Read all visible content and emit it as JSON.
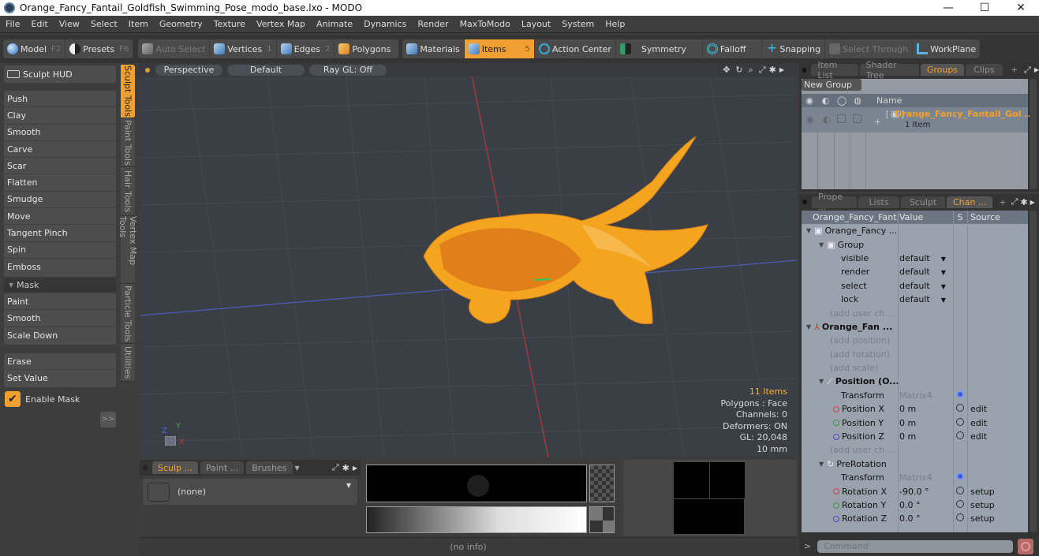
{
  "window": {
    "title": "Orange_Fancy_Fantail_Goldfish_Swimming_Pose_modo_base.lxo - MODO",
    "minimize": "—",
    "maximize": "☐",
    "close": "✕"
  },
  "menu": [
    "File",
    "Edit",
    "View",
    "Select",
    "Item",
    "Geometry",
    "Texture",
    "Vertex Map",
    "Animate",
    "Dynamics",
    "Render",
    "MaxToModo",
    "Layout",
    "System",
    "Help"
  ],
  "toolbar": {
    "model": {
      "label": "Model",
      "key": "F2"
    },
    "presets": {
      "label": "Presets",
      "key": "F6"
    },
    "auto_select": "Auto Select",
    "vertices": {
      "label": "Vertices",
      "key": "1"
    },
    "edges": {
      "label": "Edges",
      "key": "2"
    },
    "polygons": "Polygons",
    "materials": "Materials",
    "items": {
      "label": "Items",
      "key": "5"
    },
    "action_center": "Action Center",
    "symmetry": "Symmetry",
    "falloff": "Falloff",
    "snapping": "Snapping",
    "select_through": "Select Through",
    "workplane": "WorkPlane",
    "accent": "#f0a030"
  },
  "left_panel": {
    "sculpt_hud": "Sculpt HUD",
    "tools": [
      "Push",
      "Clay",
      "Smooth",
      "Carve",
      "Scar",
      "Flatten",
      "Smudge",
      "Move",
      "Tangent Pinch",
      "Spin",
      "Emboss"
    ],
    "mask_section": "Mask",
    "mask_tools_a": [
      "Paint",
      "Smooth",
      "Scale Down"
    ],
    "mask_tools_b": [
      "Erase",
      "Set Value"
    ],
    "enable_mask": "Enable Mask",
    "enable_mask_checked": true,
    "more_button": ">>",
    "vtabs": [
      "Sculpt Tools",
      "Paint Tools",
      "Hair Tools",
      "Vertex Map Tools",
      "Particle Tools",
      "Utilities"
    ]
  },
  "viewport": {
    "view_type": "Perspective",
    "shading": "Default",
    "raygl": "Ray GL: Off",
    "info": {
      "items": "11 Items",
      "polygons": "Polygons : Face",
      "channels": "Channels: 0",
      "deformers": "Deformers: ON",
      "gl": "GL: 20,048",
      "scale": "10 mm"
    },
    "axis_labels": {
      "x": "X",
      "y": "Y",
      "z": "Z"
    }
  },
  "bottom": {
    "tabs": [
      "Sculp ...",
      "Paint ...",
      "Brushes"
    ],
    "brush_value": "(none)",
    "status": "(no info)"
  },
  "groups_panel": {
    "tabs": [
      "Item List",
      "Shader Tree",
      "Groups",
      "Clips"
    ],
    "active_tab": "Groups",
    "new_group": "New Group",
    "name_header": "Name",
    "group_name": "Orange_Fancy_Fantail_Gol ...",
    "group_count": "1 Item"
  },
  "channels_panel": {
    "tabs": [
      "Prope ...",
      "Lists",
      "Sculpt",
      "Chan ..."
    ],
    "headers": {
      "name": "Orange_Fancy_Fant...",
      "value": "Value",
      "s": "S",
      "source": "Source"
    },
    "rows": [
      {
        "name": "Orange_Fancy ...",
        "value": "",
        "src": "",
        "kind": "root"
      },
      {
        "name": "Group",
        "value": "",
        "src": "",
        "kind": "group"
      },
      {
        "name": "visible",
        "value": "default",
        "src": "",
        "kind": "dropdown"
      },
      {
        "name": "render",
        "value": "default",
        "src": "",
        "kind": "dropdown"
      },
      {
        "name": "select",
        "value": "default",
        "src": "",
        "kind": "dropdown"
      },
      {
        "name": "lock",
        "value": "default",
        "src": "",
        "kind": "dropdown"
      },
      {
        "name": "(add user ch ...",
        "value": "",
        "src": "",
        "kind": "add"
      },
      {
        "name": "Orange_Fan ...",
        "value": "",
        "src": "",
        "kind": "locator"
      },
      {
        "name": "(add position)",
        "value": "",
        "src": "",
        "kind": "add"
      },
      {
        "name": "(add rotation)",
        "value": "",
        "src": "",
        "kind": "add"
      },
      {
        "name": "(add scale)",
        "value": "",
        "src": "",
        "kind": "add"
      },
      {
        "name": "Position (O...",
        "value": "",
        "src": "",
        "kind": "xform"
      },
      {
        "name": "Transform",
        "value": "Matrix4",
        "src": "",
        "kind": "matrix"
      },
      {
        "name": "Position X",
        "value": "0 m",
        "src": "edit",
        "kind": "x"
      },
      {
        "name": "Position Y",
        "value": "0 m",
        "src": "edit",
        "kind": "y"
      },
      {
        "name": "Position Z",
        "value": "0 m",
        "src": "edit",
        "kind": "z"
      },
      {
        "name": "(add user ch ...",
        "value": "",
        "src": "",
        "kind": "add"
      },
      {
        "name": "PreRotation",
        "value": "",
        "src": "",
        "kind": "xform2"
      },
      {
        "name": "Transform",
        "value": "Matrix4",
        "src": "",
        "kind": "matrix"
      },
      {
        "name": "Rotation X",
        "value": "-90.0 °",
        "src": "setup",
        "kind": "x"
      },
      {
        "name": "Rotation Y",
        "value": "0.0 °",
        "src": "setup",
        "kind": "y"
      },
      {
        "name": "Rotation Z",
        "value": "0.0 °",
        "src": "setup",
        "kind": "z"
      }
    ]
  },
  "command": {
    "placeholder": "Command"
  }
}
